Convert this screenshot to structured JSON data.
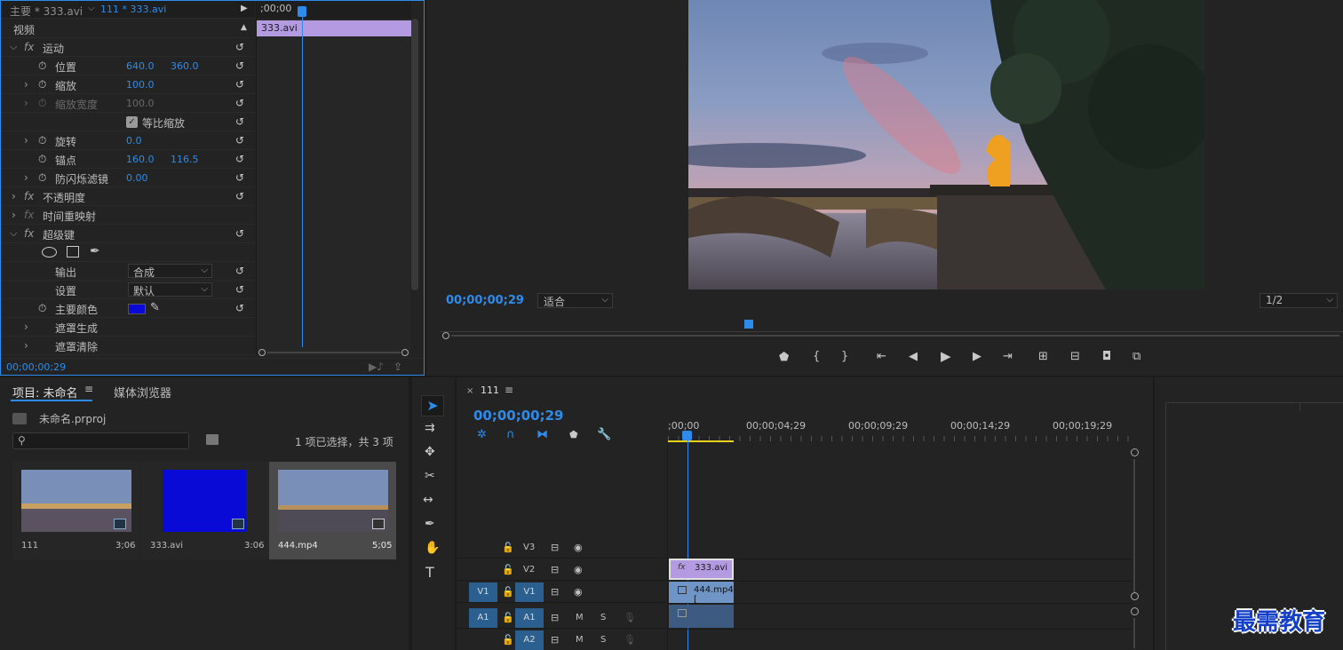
{
  "effect_controls": {
    "tab_main": "主要 * 333.avi",
    "tab_clip": "111 * 333.avi",
    "section_video": "视频",
    "clip_name": "333.avi",
    "ruler_tc": ";00;00",
    "timecode": "00;00;00;29",
    "rows": {
      "motion": "运动",
      "position": "位置",
      "position_x": "640.0",
      "position_y": "360.0",
      "scale": "缩放",
      "scale_val": "100.0",
      "scale_width": "缩放宽度",
      "scale_width_val": "100.0",
      "uniform_scale": "等比缩放",
      "rotation": "旋转",
      "rotation_val": "0.0",
      "anchor": "锚点",
      "anchor_x": "160.0",
      "anchor_y": "116.5",
      "anti_flicker": "防闪烁滤镜",
      "anti_flicker_val": "0.00",
      "opacity": "不透明度",
      "time_remap": "时间重映射",
      "ultra_key": "超级键",
      "output": "输出",
      "output_val": "合成",
      "setting": "设置",
      "setting_val": "默认",
      "key_color": "主要颜色",
      "matte_gen": "遮罩生成",
      "matte_clean": "遮罩清除"
    },
    "key_color_hex": "#0a0ad6"
  },
  "program": {
    "timecode": "00;00;00;29",
    "fit": "适合",
    "resolution": "1/2"
  },
  "project": {
    "tab_project": "项目: 未命名",
    "tab_media": "媒体浏览器",
    "file": "未命名.prproj",
    "selection": "1 项已选择，共 3 项",
    "items": [
      {
        "name": "111",
        "dur": "3;06"
      },
      {
        "name": "333.avi",
        "dur": "3:06"
      },
      {
        "name": "444.mp4",
        "dur": "5;05"
      }
    ]
  },
  "timeline": {
    "seq_name": "111",
    "timecode": "00;00;00;29",
    "ruler": [
      ";00;00",
      "00;00;04;29",
      "00;00;09;29",
      "00;00;14;29",
      "00;00;19;29"
    ],
    "tracks": {
      "v3": "V3",
      "v2": "V2",
      "v1": "V1",
      "a1": "A1",
      "a2": "A2",
      "v1_src": "V1",
      "a1_src": "A1",
      "m": "M",
      "s": "S"
    },
    "clip_v2": "333.avi",
    "clip_v1": "444.mp4 [",
    "fx": "fx"
  },
  "watermark": "最需教育"
}
